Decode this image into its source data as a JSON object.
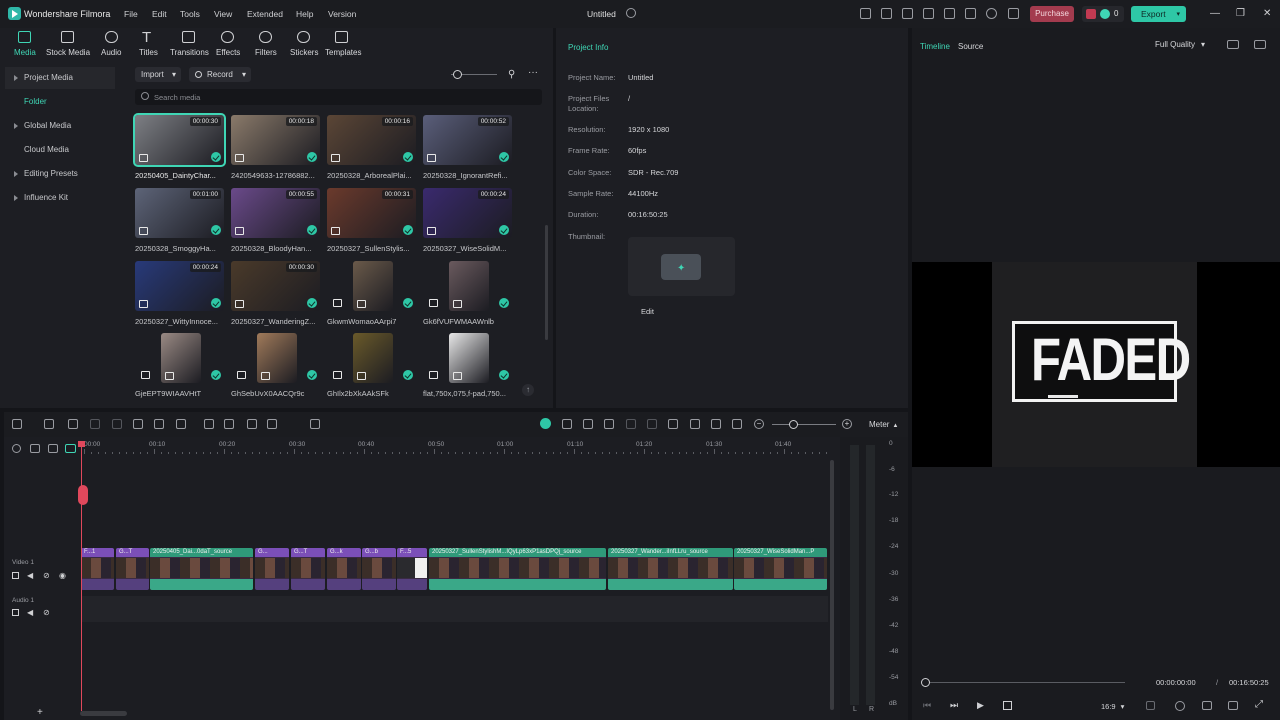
{
  "app": {
    "name": "Wondershare Filmora",
    "doc_title": "Untitled"
  },
  "menu": [
    "File",
    "Edit",
    "Tools",
    "View",
    "Extended",
    "Help",
    "Version"
  ],
  "titlebar": {
    "purchase": "Purchase",
    "points": "0",
    "export": "Export"
  },
  "media_tabs": [
    "Media",
    "Stock Media",
    "Audio",
    "Titles",
    "Transitions",
    "Effects",
    "Filters",
    "Stickers",
    "Templates"
  ],
  "sidebar": {
    "items": [
      "Project Media",
      "Folder",
      "Global Media",
      "Cloud Media",
      "Editing Presets",
      "Influence Kit"
    ]
  },
  "media_toolbar": {
    "import": "Import",
    "record": "Record",
    "search_placeholder": "Search media"
  },
  "media": [
    {
      "name": "20250405_DaintyChar...",
      "dur": "00:00:30",
      "kind": "video",
      "color": "#7d7f84"
    },
    {
      "name": "2420549633-12786882...",
      "dur": "00:00:18",
      "kind": "video",
      "color": "#8a7a6a"
    },
    {
      "name": "20250328_ArborealPlai...",
      "dur": "00:00:16",
      "kind": "video",
      "color": "#5b4636"
    },
    {
      "name": "20250328_IgnorantRefi...",
      "dur": "00:00:52",
      "kind": "video",
      "color": "#5a5e7a"
    },
    {
      "name": "20250328_SmoggyHa...",
      "dur": "00:01:00",
      "kind": "video",
      "color": "#5d6478"
    },
    {
      "name": "20250328_BloodyHan...",
      "dur": "00:00:55",
      "kind": "video",
      "color": "#6a4a8a"
    },
    {
      "name": "20250327_SullenStylis...",
      "dur": "00:00:31",
      "kind": "video",
      "color": "#6b3a2c"
    },
    {
      "name": "20250327_WiseSolidM...",
      "dur": "00:00:24",
      "kind": "video",
      "color": "#3a2a6e"
    },
    {
      "name": "20250327_WittyInnoce...",
      "dur": "00:00:24",
      "kind": "video",
      "color": "#283a7a"
    },
    {
      "name": "20250327_WanderingZ...",
      "dur": "00:00:30",
      "kind": "video",
      "color": "#4a3a2a"
    },
    {
      "name": "GkwmWomaoAArpi7",
      "dur": "",
      "kind": "image",
      "color": "#6a5a4a"
    },
    {
      "name": "Gk6fVUFWMAAWnlb",
      "dur": "",
      "kind": "image",
      "color": "#6a5a5e"
    },
    {
      "name": "GjeEPT9WIAAVHtT",
      "dur": "",
      "kind": "image",
      "color": "#9a8a84"
    },
    {
      "name": "GhSebUvX0AACQr9c",
      "dur": "",
      "kind": "image",
      "color": "#a07a5a"
    },
    {
      "name": "GhIlx2bXkAAkSFk",
      "dur": "",
      "kind": "image",
      "color": "#6a5a2a"
    },
    {
      "name": "flat,750x,075,f-pad,750...",
      "dur": "",
      "kind": "image",
      "color": "#e8e8e8"
    }
  ],
  "project_info": {
    "header": "Project Info",
    "rows": [
      {
        "label": "Project Name:",
        "value": "Untitled"
      },
      {
        "label": "Project Files Location:",
        "value": "/"
      },
      {
        "label": "Resolution:",
        "value": "1920 x 1080"
      },
      {
        "label": "Frame Rate:",
        "value": "60fps"
      },
      {
        "label": "Color Space:",
        "value": "SDR - Rec.709"
      },
      {
        "label": "Sample Rate:",
        "value": "44100Hz"
      },
      {
        "label": "Duration:",
        "value": "00:16:50:25"
      },
      {
        "label": "Thumbnail:",
        "value": ""
      }
    ],
    "edit": "Edit"
  },
  "preview": {
    "tabs": [
      "Timeline",
      "Source"
    ],
    "quality": "Full Quality",
    "overlay_text": "FADED",
    "time_current": "00:00:00:00",
    "time_sep": "/",
    "time_total": "00:16:50:25",
    "aspect": "16:9"
  },
  "timeline": {
    "meter_label": "Meter",
    "ruler": [
      "00:00",
      "00:10",
      "00:20",
      "00:30",
      "00:40",
      "00:50",
      "01:00",
      "01:10",
      "01:20",
      "01:30",
      "01:40"
    ],
    "tracks": [
      {
        "name": "Video 1"
      },
      {
        "name": "Audio 1"
      }
    ],
    "clips": [
      {
        "label": "F...1",
        "color": "#7b4fb8"
      },
      {
        "label": "G...T",
        "color": "#7b4fb8"
      },
      {
        "label": "20250405_Dai...0daT_source",
        "color": "#2f9a7a"
      },
      {
        "label": "G...",
        "color": "#7b4fb8"
      },
      {
        "label": "G...T",
        "color": "#7b4fb8"
      },
      {
        "label": "G...k",
        "color": "#7b4fb8"
      },
      {
        "label": "G...b",
        "color": "#7b4fb8"
      },
      {
        "label": "F...5",
        "color": "#7b4fb8"
      },
      {
        "label": "20250327_SullenStylishM...IQyLp63xP1asDPQj_source",
        "color": "#2f9a7a"
      },
      {
        "label": "20250327_Wander...iInfLLru_source",
        "color": "#2f9a7a"
      },
      {
        "label": "20250327_WiseSolidMan...P",
        "color": "#2f9a7a"
      }
    ],
    "meter_scale": [
      "0",
      "-6",
      "-12",
      "-18",
      "-24",
      "-30",
      "-36",
      "-42",
      "-48",
      "-54",
      "dB"
    ],
    "meter_lr": [
      "L",
      "R"
    ]
  }
}
